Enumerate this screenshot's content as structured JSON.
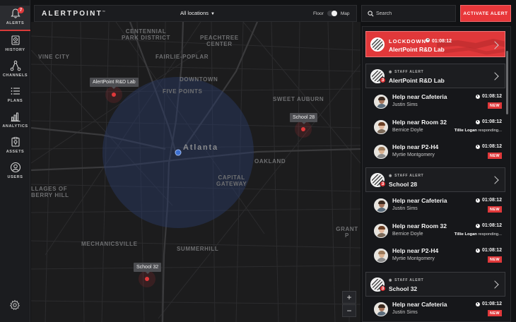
{
  "sidebar": {
    "items": [
      {
        "label": "ALERTS",
        "icon": "bell-icon",
        "badge": "7",
        "active": true
      },
      {
        "label": "HISTORY",
        "icon": "history-icon"
      },
      {
        "label": "CHANNELS",
        "icon": "channels-icon"
      },
      {
        "label": "PLANS",
        "icon": "plans-icon"
      },
      {
        "label": "ANALYTICS",
        "icon": "analytics-icon"
      },
      {
        "label": "ASSETS",
        "icon": "assets-icon"
      },
      {
        "label": "USERS",
        "icon": "users-icon"
      }
    ],
    "settings_icon": "gear-icon"
  },
  "header": {
    "logo": "ALERTPOINT",
    "logo_mark": "™",
    "location_select": "All locations",
    "toggle_left": "Floor",
    "toggle_right": "Map"
  },
  "search": {
    "placeholder": "Search",
    "value": ""
  },
  "activate_button": "ACTIVATE ALERT",
  "map": {
    "districts": [
      "CENTENNIAL\nPARK DISTRICT",
      "PEACHTREE\nCENTER",
      "FAIRLIE-POPLAR",
      "VINE CITY",
      "DOWNTOWN",
      "FIVE POINTS",
      "SWEET AUBURN",
      "OAKLAND",
      "CAPITAL\nGATEWAY",
      "LLAGES OF\nBERRY HILL",
      "MECHANICSVILLE",
      "SUMMERHILL",
      "GRANT P"
    ],
    "city": "Atlanta",
    "pins": [
      "AlertPoint R&D Lab",
      "School 28",
      "School 32"
    ],
    "zoom_in": "+",
    "zoom_out": "−"
  },
  "panel": {
    "lockdown": {
      "title": "LOCKDOWN",
      "time": "01:08:12",
      "name": "AlertPoint R&D Lab"
    },
    "groups": [
      {
        "tag": "STAFF ALERT",
        "name": "AlertPoint R&D Lab",
        "count": "3",
        "items": [
          {
            "title": "Help near Cafeteria",
            "person": "Justin Sims",
            "time": "01:08:12",
            "status": "NEW"
          },
          {
            "title": "Help near Room 32",
            "person": "Bernice Doyle",
            "time": "01:08:12",
            "responder": "Tillie Logan",
            "responding": "responding..."
          },
          {
            "title": "Help near P2-H4",
            "person": "Myrtie Montgomery",
            "time": "01:08:12",
            "status": "NEW"
          }
        ]
      },
      {
        "tag": "STAFF ALERT",
        "name": "School 28",
        "count": "3",
        "items": [
          {
            "title": "Help near Cafeteria",
            "person": "Justin Sims",
            "time": "01:08:12",
            "status": "NEW"
          },
          {
            "title": "Help near Room 32",
            "person": "Bernice Doyle",
            "time": "01:08:12",
            "responder": "Tillie Logan",
            "responding": "responding..."
          },
          {
            "title": "Help near P2-H4",
            "person": "Myrtie Montgomery",
            "time": "01:08:12",
            "status": "NEW"
          }
        ]
      },
      {
        "tag": "STAFF ALERT",
        "name": "School 32",
        "count": "3",
        "items": [
          {
            "title": "Help near Cafeteria",
            "person": "Justin Sims",
            "time": "01:08:12",
            "status": "NEW"
          }
        ]
      }
    ]
  },
  "colors": {
    "accent": "#e0383a",
    "background": "#111214",
    "panel": "#1b1c1f",
    "user_dot": "#3b6fd1"
  }
}
